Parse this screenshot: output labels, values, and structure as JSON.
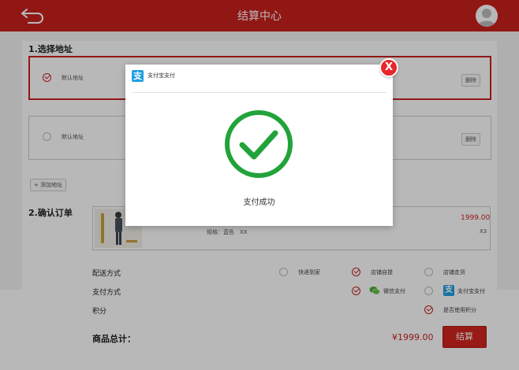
{
  "header": {
    "title": "结算中心"
  },
  "address_section": {
    "title": "1.选择地址",
    "addresses": [
      {
        "label": "默认地址",
        "delete_label": "删除",
        "selected": true
      },
      {
        "label": "默认地址",
        "delete_label": "删除",
        "selected": false
      }
    ],
    "add_label": "+ 添加地址"
  },
  "order_section": {
    "title": "2.确认订单",
    "product": {
      "price": "1999.00",
      "spec": "规格：蓝色　XX",
      "quantity": "X3"
    }
  },
  "delivery": {
    "label": "配送方式",
    "options": [
      {
        "label": "快递到家",
        "selected": false
      },
      {
        "label": "店铺自提",
        "selected": true
      },
      {
        "label": "店铺走货",
        "selected": false
      }
    ]
  },
  "payment": {
    "label": "支付方式",
    "options": [
      {
        "label": "微信支付",
        "selected": true
      },
      {
        "label": "支付宝支付",
        "selected": false
      }
    ]
  },
  "points": {
    "label": "积分",
    "option_label": "是否使用积分",
    "selected": true
  },
  "summary": {
    "total_label": "商品总计：",
    "total_value": "¥1999.00",
    "pay_label": "结算"
  },
  "modal": {
    "title": "支付宝支付",
    "logo_glyph": "支",
    "message": "支付成功",
    "close_glyph": "X"
  },
  "colors": {
    "primary": "#c9201e",
    "success": "#22a33a",
    "alipay": "#1f9ee3",
    "wechat": "#4cae35"
  }
}
